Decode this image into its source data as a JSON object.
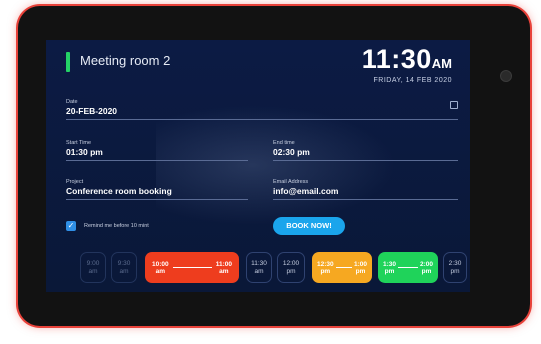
{
  "room": {
    "name": "Meeting room 2",
    "indicator_color": "#24d266"
  },
  "clock": {
    "time": "11:30",
    "ampm": "AM",
    "date": "FRIDAY, 14 FEB 2020"
  },
  "form": {
    "date": {
      "label": "Date",
      "value": "20-FEB-2020",
      "icon": "calendar-icon"
    },
    "start_time": {
      "label": "Start Time",
      "value": "01:30 pm"
    },
    "end_time": {
      "label": "End time",
      "value": "02:30 pm"
    },
    "project": {
      "label": "Project",
      "value": "Conference room booking"
    },
    "email": {
      "label": "Email Address",
      "value": "info@email.com"
    },
    "remind": {
      "label": "Remind me before 10 mint",
      "checked": true
    },
    "book_button": "BOOK NOW!"
  },
  "slots": [
    {
      "start": "9:00",
      "start_ampm": "am",
      "status": "past"
    },
    {
      "start": "9:30",
      "start_ampm": "am",
      "status": "past"
    },
    {
      "start": "10:00",
      "start_ampm": "am",
      "end": "11:00",
      "end_ampm": "am",
      "status": "booked",
      "color": "#ee3d1e"
    },
    {
      "start": "11:30",
      "start_ampm": "am",
      "status": "free"
    },
    {
      "start": "12:00",
      "start_ampm": "pm",
      "status": "free"
    },
    {
      "start": "12:30",
      "start_ampm": "pm",
      "end": "1:00",
      "end_ampm": "pm",
      "status": "pending",
      "color": "#f6a821"
    },
    {
      "start": "1:30",
      "start_ampm": "pm",
      "end": "2:00",
      "end_ampm": "pm",
      "status": "selected",
      "color": "#1fd35a"
    },
    {
      "start": "2:30",
      "start_ampm": "pm",
      "status": "free"
    }
  ],
  "colors": {
    "accent": "#1aa5ec",
    "background": "#0c1b44",
    "frame_glow": "#e8423a"
  }
}
